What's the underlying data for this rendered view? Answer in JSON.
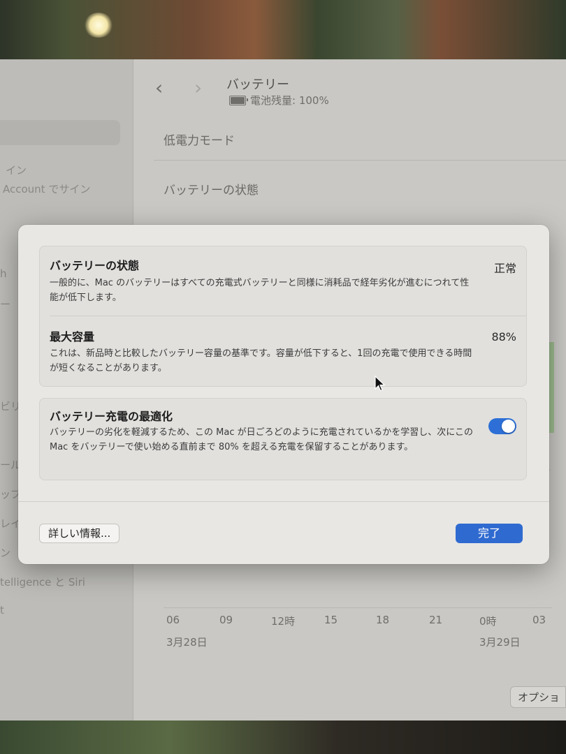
{
  "window": {
    "title": "バッテリー",
    "battery_status": "電池残量: 100%",
    "rows": [
      "低電力モード",
      "バッテリーの状態"
    ]
  },
  "sidebar": {
    "fragments": [
      "イン",
      "Account でサイン",
      "h",
      "ー",
      "ビリ",
      "ール",
      "ップ",
      "レイ",
      "ン",
      "telligence と Siri",
      "t"
    ]
  },
  "chart": {
    "x_ticks": [
      "06",
      "09",
      "12時",
      "15",
      "18",
      "21",
      "0時",
      "03"
    ],
    "dates": [
      "3月28日",
      "3月29日"
    ],
    "peek_value": "3",
    "options_label": "オプショ"
  },
  "modal": {
    "health": {
      "title": "バッテリーの状態",
      "description": "一般的に、Mac のバッテリーはすべての充電式バッテリーと同様に消耗品で経年劣化が進むにつれて性能が低下します。",
      "value": "正常"
    },
    "capacity": {
      "title": "最大容量",
      "description": "これは、新品時と比較したバッテリー容量の基準です。容量が低下すると、1回の充電で使用できる時間が短くなることがあります。",
      "value": "88%"
    },
    "optimize": {
      "title": "バッテリー充電の最適化",
      "description": "バッテリーの劣化を軽減するため、この Mac が日ごろどのように充電されているかを学習し、次にこの Mac をバッテリーで使い始める直前まで 80% を超える充電を保留することがあります。",
      "enabled": true
    },
    "more_info_label": "詳しい情報...",
    "done_label": "完了"
  },
  "colors": {
    "accent": "#2f6ad0",
    "modal_bg": "#e8e7e4"
  }
}
